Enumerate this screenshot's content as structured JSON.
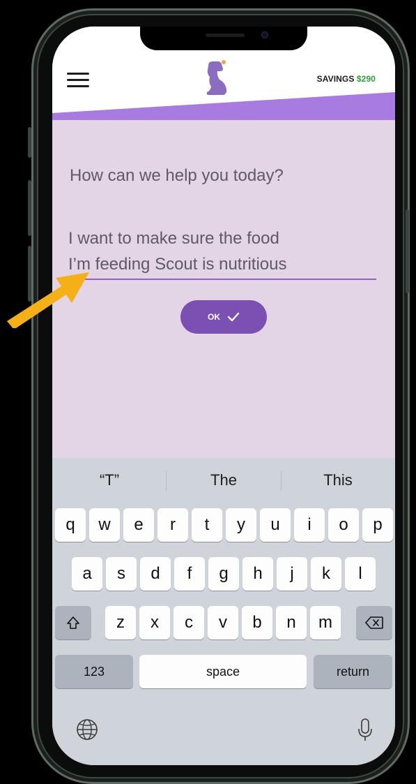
{
  "header": {
    "savings_label": "SAVINGS",
    "savings_amount": "$290",
    "accent_color": "#a87be0",
    "icons": [
      "menu-icon",
      "dog-logo-icon"
    ]
  },
  "content": {
    "question": "How can we help you today?",
    "answer_line1": "I want to make sure the food",
    "answer_line2": "I’m feeding Scout is nutritious",
    "ok_label": "OK",
    "background_color": "#e3d5e6",
    "button_color": "#7a51b2"
  },
  "annotation": {
    "arrow_color": "#f6b017",
    "icon": "arrow-icon"
  },
  "keyboard": {
    "suggestions": [
      "“T”",
      "The",
      "This"
    ],
    "row1": [
      "q",
      "w",
      "e",
      "r",
      "t",
      "y",
      "u",
      "i",
      "o",
      "p"
    ],
    "row2": [
      "a",
      "s",
      "d",
      "f",
      "g",
      "h",
      "j",
      "k",
      "l"
    ],
    "row3": [
      "z",
      "x",
      "c",
      "v",
      "b",
      "n",
      "m"
    ],
    "numbers_label": "123",
    "space_label": "space",
    "return_label": "return",
    "icons": [
      "shift-icon",
      "backspace-icon",
      "globe-icon",
      "microphone-icon"
    ]
  }
}
